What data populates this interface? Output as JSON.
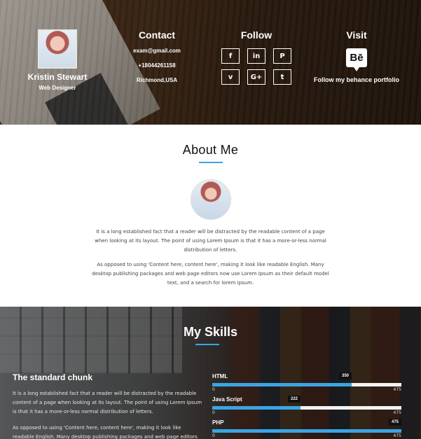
{
  "header": {
    "profile": {
      "name": "Kristin Stewart",
      "role": "Web Designer"
    },
    "contact": {
      "title": "Contact",
      "email": "exam@gmail.com",
      "phone": "+18044261158",
      "location": "Richmond,USA"
    },
    "follow": {
      "title": "Follow",
      "buttons": [
        {
          "glyph": "f",
          "icon": "facebook-icon"
        },
        {
          "glyph": "in",
          "icon": "linkedin-icon"
        },
        {
          "glyph": "P",
          "icon": "pinterest-icon"
        },
        {
          "glyph": "v",
          "icon": "vimeo-icon"
        },
        {
          "glyph": "G+",
          "icon": "google-plus-icon"
        },
        {
          "glyph": "t",
          "icon": "tumblr-icon"
        }
      ]
    },
    "visit": {
      "title": "Visit",
      "icon_text": "Bē",
      "link_text": "Follow my behance portfolio"
    }
  },
  "about": {
    "title": "About Me",
    "paragraphs": [
      "It is a long established fact that a reader will be distracted by the readable content of a page when looking at its layout. The point of using Lorem Ipsum is that it has a more-or-less normal distribution of letters.",
      "As opposed to using 'Content here, content here', making it look like readable English. Many desktop publishing packages and web page editors now use Lorem Ipsum as their default model text, and a search for lorem ipsum."
    ]
  },
  "skills": {
    "title": "My Skills",
    "chunk_title": "The standard chunk",
    "chunk_paragraphs": [
      "It is a long established fact that a reader will be distracted by the readable content of a page when looking at its layout. The point of using Lorem Ipsum is that it has a more-or-less normal distribution of letters.",
      "As opposed to using 'Content here, content here', making it look like readable English. Many desktop publishing packages and web page editors now use"
    ],
    "bars": [
      {
        "name": "HTML",
        "value": 350,
        "min": 0,
        "max": 475
      },
      {
        "name": "Java Script",
        "value": 222,
        "min": 0,
        "max": 475
      },
      {
        "name": "PHP",
        "value": 475,
        "min": 0,
        "max": 475
      }
    ]
  },
  "colors": {
    "accent": "#3ba4e4",
    "bubble": "#111111"
  }
}
